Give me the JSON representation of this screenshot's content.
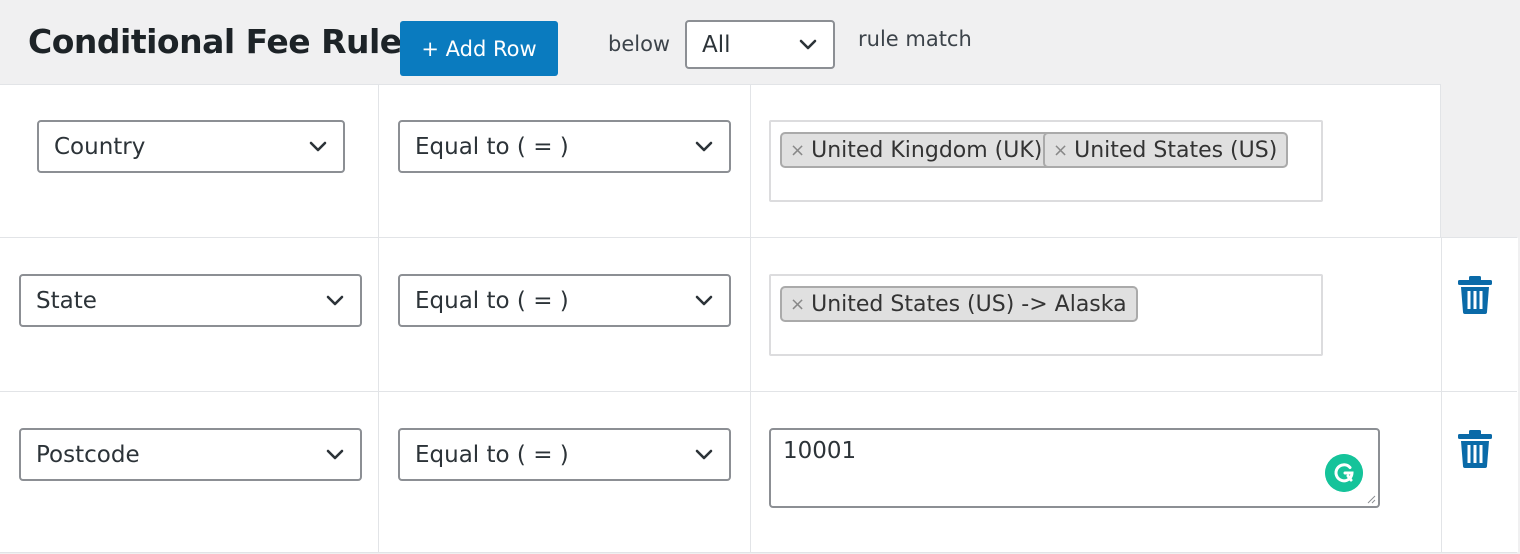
{
  "header": {
    "title": "Conditional Fee Rule",
    "add_row_label": "+ Add Row",
    "below_label": "below",
    "match_value": "All",
    "rule_match_label": "rule match"
  },
  "rows": [
    {
      "field": "Country",
      "operator": "Equal to ( = )",
      "tags": [
        "United Kingdom (UK)",
        "United States (US)"
      ]
    },
    {
      "field": "State",
      "operator": "Equal to ( = )",
      "tags": [
        "United States (US) -> Alaska"
      ]
    },
    {
      "field": "Postcode",
      "operator": "Equal to ( = )",
      "value": "10001"
    }
  ],
  "icons": {
    "dropdown": "chevron-down-icon",
    "remove_tag": "close-icon",
    "delete": "trash-icon",
    "grammarly": "grammarly-icon"
  },
  "colors": {
    "primary_button": "#0a7bbf",
    "trash_icon": "#0a6aa8",
    "grammarly": "#15c39a"
  }
}
